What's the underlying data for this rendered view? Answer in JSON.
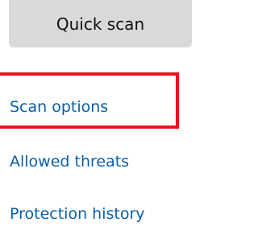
{
  "quick_scan": {
    "label": "Quick scan"
  },
  "links": {
    "scan_options": "Scan options",
    "allowed_threats": "Allowed threats",
    "protection_history": "Protection history"
  },
  "colors": {
    "link": "#0a5ea8",
    "button_bg": "#d9d9d9",
    "highlight": "#e8141b"
  }
}
